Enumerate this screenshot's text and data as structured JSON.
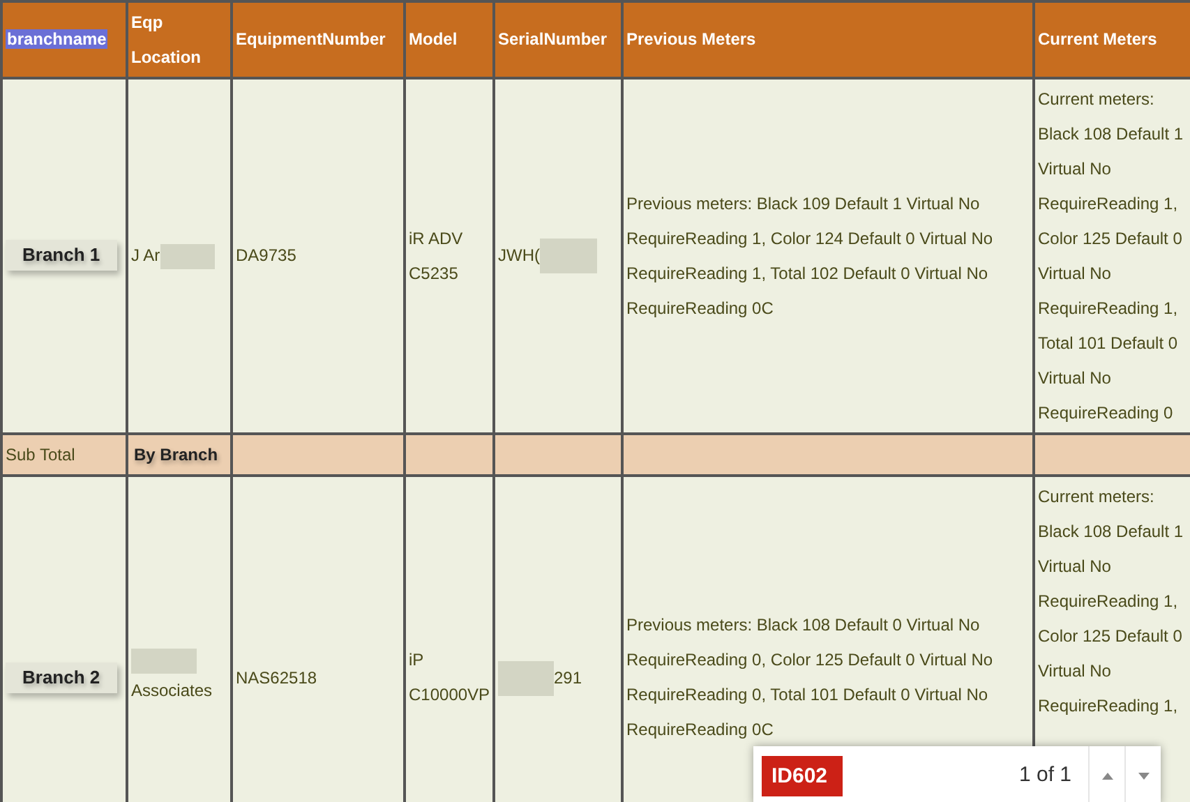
{
  "table": {
    "columns": [
      {
        "label": "branchname",
        "highlighted": true
      },
      {
        "label": "Eqp Location",
        "highlighted": false
      },
      {
        "label": "EquipmentNumber",
        "highlighted": false
      },
      {
        "label": "Model",
        "highlighted": false
      },
      {
        "label": "SerialNumber",
        "highlighted": false
      },
      {
        "label": "Previous Meters",
        "highlighted": false
      },
      {
        "label": "Current Meters",
        "highlighted": false
      }
    ],
    "rows": [
      {
        "kind": "item",
        "branch": "Branch 1",
        "location_before": "J Ar",
        "location_after": "",
        "equipment_number": "DA9735",
        "model": "iR ADV C5235",
        "serial_before": "JWH(",
        "serial_after": "",
        "previous_meters": "Previous meters: Black 109 Default 1 Virtual No RequireReading 1, Color 124 Default 0 Virtual No RequireReading 1, Total 102 Default 0 Virtual No RequireReading 0C",
        "current_meters": "Current meters: Black 108 Default 1 Virtual No RequireReading 1, Color 125 Default 0 Virtual No RequireReading 1, Total 101 Default 0 Virtual No RequireReading 0"
      },
      {
        "kind": "subtotal",
        "label": "Sub Total",
        "group": "By Branch"
      },
      {
        "kind": "item",
        "branch": "Branch 2",
        "location_before": "",
        "location_after": "Associates",
        "equipment_number": "NAS62518",
        "model": "iP C10000VP",
        "serial_before": "",
        "serial_after": "291",
        "previous_meters": "Previous meters: Black 108 Default 0 Virtual No RequireReading 0, Color 125 Default 0 Virtual No RequireReading 0, Total 101 Default 0 Virtual No RequireReading 0C",
        "current_meters": "Current meters: Black 108 Default 1 Virtual No RequireReading 1, Color 125 Default 0 Virtual No RequireReading 1,"
      }
    ]
  },
  "find_bar": {
    "tag": "ID602",
    "count": "1 of 1"
  }
}
